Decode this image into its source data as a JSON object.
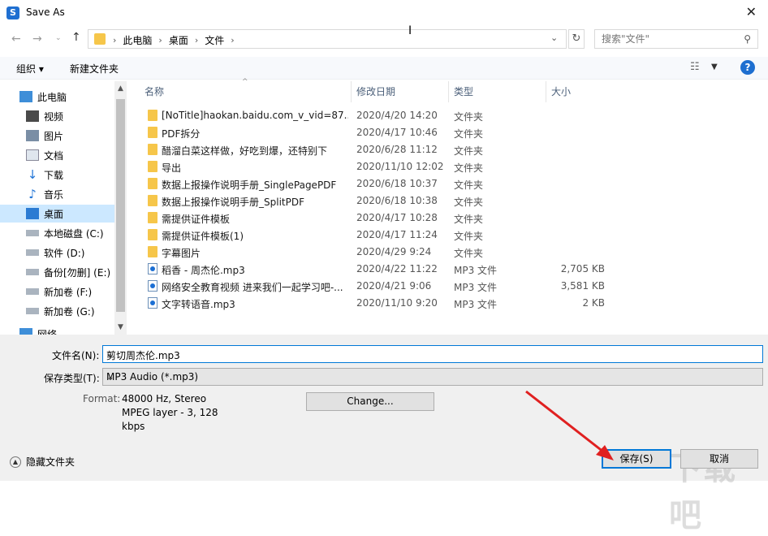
{
  "window": {
    "title": "Save As"
  },
  "address": {
    "crumbs": [
      "此电脑",
      "桌面",
      "文件"
    ]
  },
  "search": {
    "placeholder": "搜索\"文件\""
  },
  "toolbar": {
    "organize": "组织 ▾",
    "new_folder": "新建文件夹"
  },
  "sidebar": {
    "items": [
      {
        "label": "此电脑",
        "icon": "computer-icon"
      },
      {
        "label": "视频",
        "icon": "video-icon"
      },
      {
        "label": "图片",
        "icon": "picture-icon"
      },
      {
        "label": "文档",
        "icon": "document-icon"
      },
      {
        "label": "下载",
        "icon": "download-icon"
      },
      {
        "label": "音乐",
        "icon": "music-icon"
      },
      {
        "label": "桌面",
        "icon": "desktop-icon"
      },
      {
        "label": "本地磁盘 (C:)",
        "icon": "drive-icon"
      },
      {
        "label": "软件 (D:)",
        "icon": "drive-icon"
      },
      {
        "label": "备份[勿删] (E:)",
        "icon": "drive-icon"
      },
      {
        "label": "新加卷 (F:)",
        "icon": "drive-icon"
      },
      {
        "label": "新加卷 (G:)",
        "icon": "drive-icon"
      },
      {
        "label": "网络",
        "icon": "network-icon"
      }
    ]
  },
  "columns": {
    "name": "名称",
    "date": "修改日期",
    "type": "类型",
    "size": "大小"
  },
  "files": [
    {
      "name": "[NoTitle]haokan.baidu.com_v_vid=87...",
      "date": "2020/4/20 14:20",
      "type": "文件夹",
      "size": "",
      "kind": "folder"
    },
    {
      "name": "PDF拆分",
      "date": "2020/4/17 10:46",
      "type": "文件夹",
      "size": "",
      "kind": "folder"
    },
    {
      "name": "醋溜白菜这样做，好吃到爆，还特别下",
      "date": "2020/6/28 11:12",
      "type": "文件夹",
      "size": "",
      "kind": "folder"
    },
    {
      "name": "导出",
      "date": "2020/11/10 12:02",
      "type": "文件夹",
      "size": "",
      "kind": "folder"
    },
    {
      "name": "数据上报操作说明手册_SinglePagePDF",
      "date": "2020/6/18 10:37",
      "type": "文件夹",
      "size": "",
      "kind": "folder"
    },
    {
      "name": "数据上报操作说明手册_SplitPDF",
      "date": "2020/6/18 10:38",
      "type": "文件夹",
      "size": "",
      "kind": "folder"
    },
    {
      "name": "需提供证件模板",
      "date": "2020/4/17 10:28",
      "type": "文件夹",
      "size": "",
      "kind": "folder"
    },
    {
      "name": "需提供证件模板(1)",
      "date": "2020/4/17 11:24",
      "type": "文件夹",
      "size": "",
      "kind": "folder"
    },
    {
      "name": "字幕图片",
      "date": "2020/4/29 9:24",
      "type": "文件夹",
      "size": "",
      "kind": "folder"
    },
    {
      "name": "稻香 - 周杰伦.mp3",
      "date": "2020/4/22 11:22",
      "type": "MP3 文件",
      "size": "2,705 KB",
      "kind": "mp3"
    },
    {
      "name": "网络安全教育视频 进来我们一起学习吧-...",
      "date": "2020/4/21 9:06",
      "type": "MP3 文件",
      "size": "3,581 KB",
      "kind": "mp3"
    },
    {
      "name": "文字转语音.mp3",
      "date": "2020/11/10 9:20",
      "type": "MP3 文件",
      "size": "2 KB",
      "kind": "mp3"
    }
  ],
  "form": {
    "filename_label": "文件名(N):",
    "filename_value": "剪切周杰伦.mp3",
    "filetype_label": "保存类型(T):",
    "filetype_value": "MP3 Audio (*.mp3)",
    "format_label": "Format:",
    "format_lines": [
      "48000 Hz, Stereo",
      "MPEG layer - 3, 128",
      "kbps"
    ],
    "change_button": "Change..."
  },
  "footer": {
    "hide_folders": "隐藏文件夹",
    "save_button": "保存(S)",
    "cancel_button": "取消"
  },
  "watermark": "下载吧"
}
